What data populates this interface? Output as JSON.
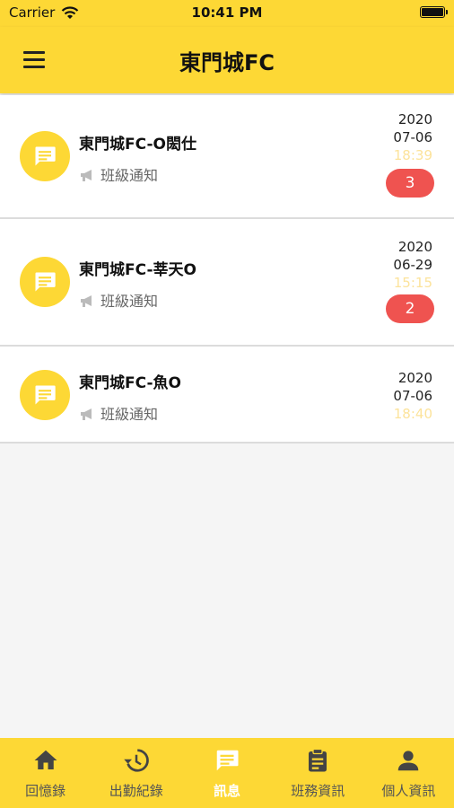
{
  "status_bar": {
    "carrier": "Carrier",
    "time": "10:41 PM"
  },
  "header": {
    "title": "東門城FC"
  },
  "messages": [
    {
      "name": "東門城FC-O閎仕",
      "category": "班級通知",
      "year": "2020",
      "date": "07-06",
      "time": "18:39",
      "unread": "3"
    },
    {
      "name": "東門城FC-莘天O",
      "category": "班級通知",
      "year": "2020",
      "date": "06-29",
      "time": "15:15",
      "unread": "2"
    },
    {
      "name": "東門城FC-魚O",
      "category": "班級通知",
      "year": "2020",
      "date": "07-06",
      "time": "18:40",
      "unread": ""
    }
  ],
  "tabs": [
    {
      "label": "回憶錄",
      "icon": "home-icon"
    },
    {
      "label": "出勤紀錄",
      "icon": "history-icon"
    },
    {
      "label": "訊息",
      "icon": "chat-icon",
      "active": true
    },
    {
      "label": "班務資訊",
      "icon": "clipboard-icon"
    },
    {
      "label": "個人資訊",
      "icon": "person-icon"
    }
  ],
  "colors": {
    "accent": "#fdd835",
    "badge": "#ef5350",
    "time_text": "#fce39b"
  }
}
